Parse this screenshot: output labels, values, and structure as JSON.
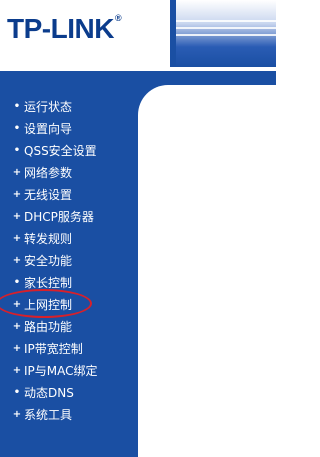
{
  "header": {
    "logo_text": "TP-LINK",
    "logo_reg": "®"
  },
  "menu": {
    "items": [
      {
        "label": "运行状态",
        "marker": "•"
      },
      {
        "label": "设置向导",
        "marker": "•"
      },
      {
        "label": "QSS安全设置",
        "marker": "•"
      },
      {
        "label": "网络参数",
        "marker": "+"
      },
      {
        "label": "无线设置",
        "marker": "+"
      },
      {
        "label": "DHCP服务器",
        "marker": "+"
      },
      {
        "label": "转发规则",
        "marker": "+"
      },
      {
        "label": "安全功能",
        "marker": "+"
      },
      {
        "label": "家长控制",
        "marker": "•"
      },
      {
        "label": "上网控制",
        "marker": "+",
        "highlighted": true
      },
      {
        "label": "路由功能",
        "marker": "+"
      },
      {
        "label": "IP带宽控制",
        "marker": "+"
      },
      {
        "label": "IP与MAC绑定",
        "marker": "+"
      },
      {
        "label": "动态DNS",
        "marker": "•"
      },
      {
        "label": "系统工具",
        "marker": "+"
      }
    ]
  },
  "colors": {
    "brand_blue": "#1a4fa3",
    "logo_blue": "#0b3c8c",
    "highlight_red": "#d8202a"
  }
}
